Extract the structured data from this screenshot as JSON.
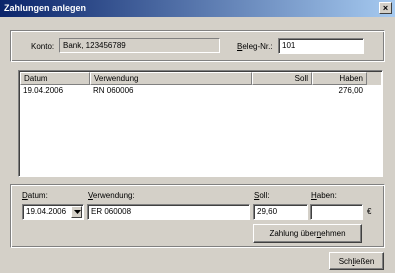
{
  "window": {
    "title": "Zahlungen anlegen",
    "close": "×"
  },
  "account": {
    "konto_label": "Konto:",
    "konto_value": "Bank, 123456789",
    "beleg_label_pre": "",
    "beleg_label_ul": "B",
    "beleg_label_post": "eleg-Nr.:",
    "beleg_value": "101"
  },
  "list": {
    "columns": [
      "Datum",
      "Verwendung",
      "Soll",
      "Haben"
    ],
    "rows": [
      {
        "datum": "19.04.2006",
        "verwendung": "RN 060006",
        "soll": "",
        "haben": "276,00"
      }
    ]
  },
  "entry": {
    "datum_label_ul": "D",
    "datum_label_post": "atum:",
    "verwendung_label_ul": "V",
    "verwendung_label_post": "erwendung:",
    "soll_label_ul": "S",
    "soll_label_post": "oll:",
    "haben_label_ul": "H",
    "haben_label_post": "aben:",
    "datum_value": "19.04.2006",
    "verwendung_value": "ER 060008",
    "soll_value": "29,60",
    "haben_value": "",
    "currency": "€",
    "submit_pre": "Zahlung über",
    "submit_ul": "n",
    "submit_post": "ehmen"
  },
  "footer": {
    "close_pre": "Sch",
    "close_ul": "l",
    "close_post": "ießen"
  }
}
